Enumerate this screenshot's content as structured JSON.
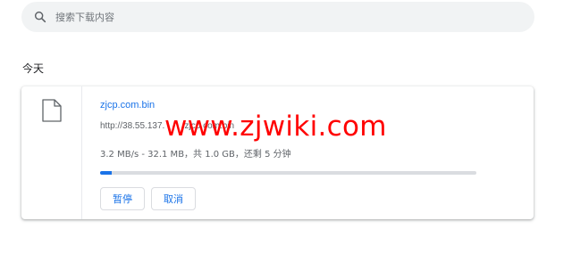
{
  "search": {
    "placeholder": "搜索下载内容",
    "icon": "search-icon"
  },
  "section": {
    "label": "今天"
  },
  "download": {
    "file_icon": "file-icon",
    "file_name": "zjcp.com.bin",
    "url": "http://38.55.137.  .  .  . /zjcp.com.bin",
    "status": "3.2 MB/s - 32.1 MB，共 1.0 GB，还剩 5 分钟",
    "progress": 0.03,
    "pause_label": "暂停",
    "cancel_label": "取消"
  },
  "watermark": {
    "text": "www.zjwiki.com",
    "color": "#ff0000"
  },
  "colors": {
    "accent": "#1a73e8",
    "search_bg": "#f1f3f4",
    "track": "#dadce0"
  }
}
